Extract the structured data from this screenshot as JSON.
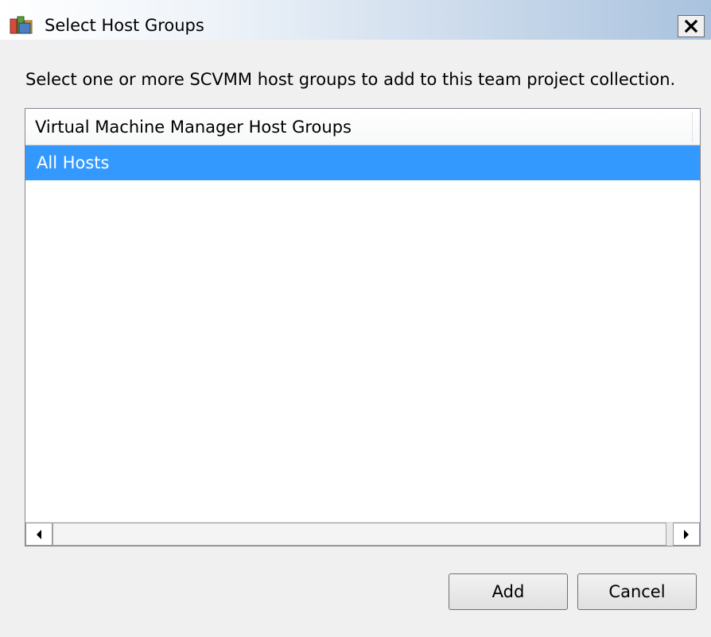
{
  "window": {
    "title": "Select Host Groups",
    "title_icon": "scvmm-app-icon",
    "close_icon": "close-icon"
  },
  "dialog": {
    "instruction": "Select one or more SCVMM host groups to add to this team project collection."
  },
  "list": {
    "column_header": "Virtual Machine Manager Host Groups",
    "rows": [
      {
        "label": "All Hosts",
        "selected": true
      }
    ],
    "selection_color": "#3399ff"
  },
  "buttons": {
    "add_label": "Add",
    "cancel_label": "Cancel"
  }
}
